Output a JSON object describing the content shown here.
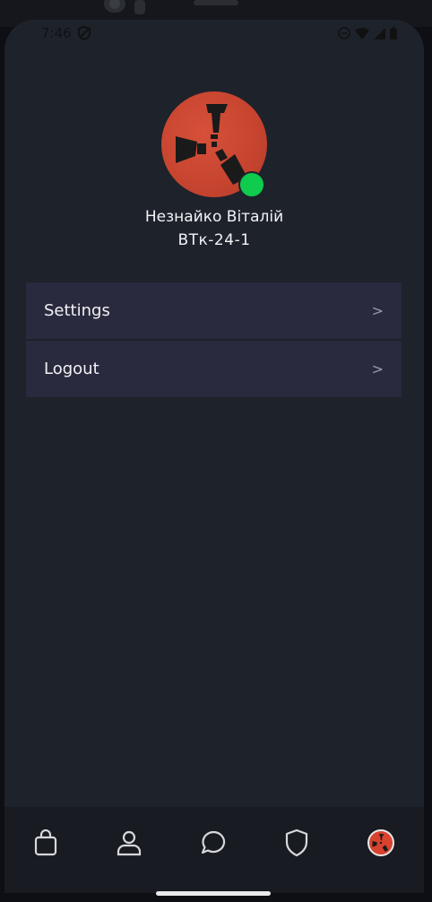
{
  "status_bar": {
    "time": "7:46",
    "icons": [
      "vpn-shield-icon",
      "do-not-disturb-icon",
      "wifi-icon",
      "signal-icon",
      "battery-icon"
    ]
  },
  "profile": {
    "name": "Незнайко Віталій",
    "group": "ВТк-24-1",
    "online_color": "#0fcb4e",
    "avatar_color": "#c6442f"
  },
  "menu": {
    "items": [
      {
        "label": "Settings",
        "chevron": ">"
      },
      {
        "label": "Logout",
        "chevron": ">"
      }
    ]
  },
  "tabbar": {
    "tabs": [
      "shop-bag-icon",
      "profile-person-icon",
      "chat-bubble-icon",
      "shield-icon",
      "avatar-tab-icon"
    ]
  },
  "colors": {
    "background": "#1e222b",
    "menu_item": "#292a3e",
    "tabbar": "#181b21"
  }
}
